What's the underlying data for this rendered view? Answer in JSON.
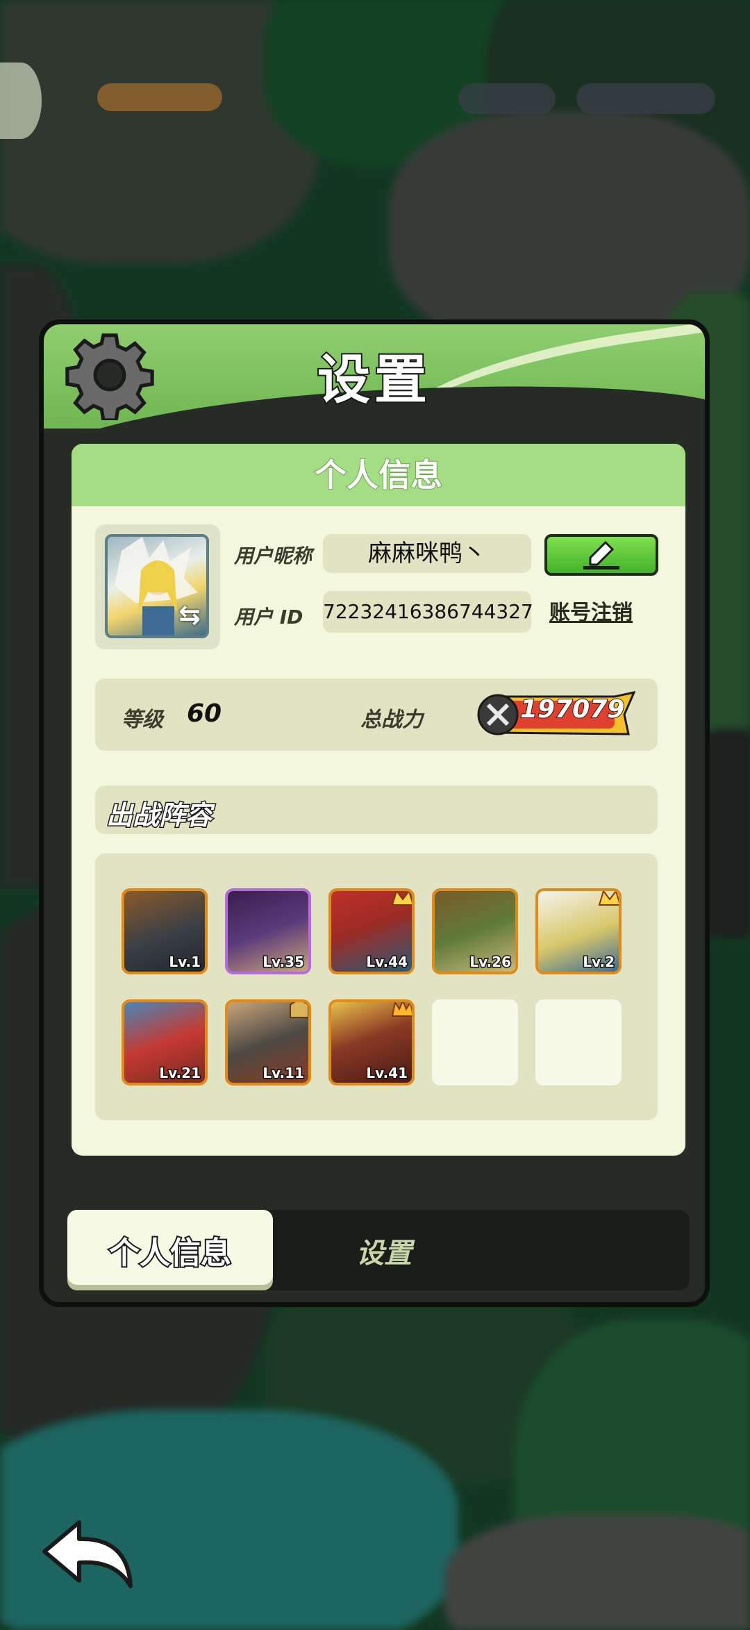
{
  "dialog": {
    "title": "设置",
    "section_title": "个人信息",
    "profile": {
      "nickname_label": "用户昵称",
      "nickname": "麻麻咪鸭丶",
      "id_label": "用户 ID",
      "user_id": "72232416386744327",
      "cancel_account_label": "账号注销",
      "edit_icon": "pencil-icon"
    },
    "stats": {
      "level_label": "等级",
      "level": "60",
      "power_label": "总战力",
      "power": "197079"
    },
    "team": {
      "title": "出战阵容",
      "heroes": [
        {
          "lv": "Lv.1",
          "rarity": "legendary",
          "color": "#3a3f46"
        },
        {
          "lv": "Lv.35",
          "rarity": "epic",
          "color": "#5b3a7a"
        },
        {
          "lv": "Lv.44",
          "rarity": "legendary",
          "color": "#9b2b25"
        },
        {
          "lv": "Lv.26",
          "rarity": "legendary",
          "color": "#5f7a3a"
        },
        {
          "lv": "Lv.2",
          "rarity": "legendary",
          "color": "#d8c76a"
        },
        {
          "lv": "Lv.21",
          "rarity": "legendary",
          "color": "#c43a32"
        },
        {
          "lv": "Lv.11",
          "rarity": "legendary",
          "color": "#4d4a44"
        },
        {
          "lv": "Lv.41",
          "rarity": "legendary",
          "color": "#8a3a24"
        }
      ],
      "empty_slots": 2
    }
  },
  "tabs": {
    "active": "个人信息",
    "inactive": "设置"
  },
  "colors": {
    "header_green": "#8fce6f",
    "panel_bg": "#f3f7dd",
    "legendary_border": "#e08a1a",
    "epic_border": "#b56ae0"
  }
}
